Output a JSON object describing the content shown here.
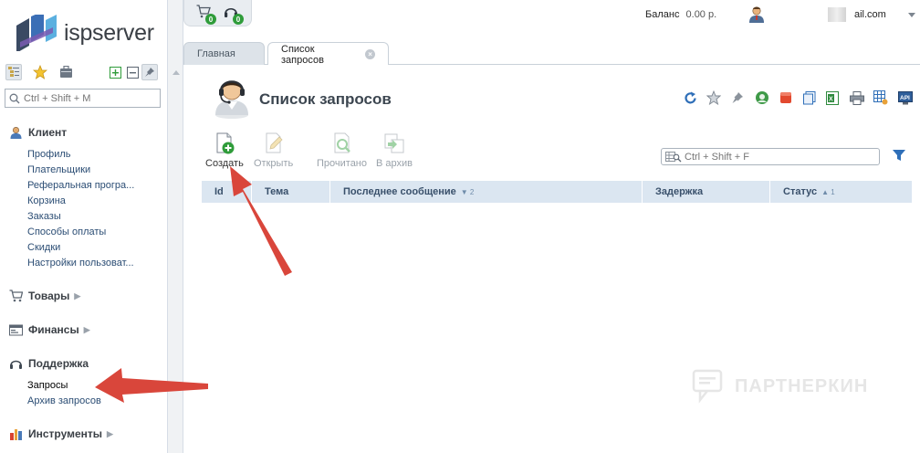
{
  "brand": {
    "logo_text": "ispserver"
  },
  "topbar": {
    "cart_badge": "0",
    "support_badge": "0",
    "balance_label": "Баланс",
    "balance_value": "0.00 р.",
    "user_email": "ail.com"
  },
  "sidebar": {
    "search_placeholder": "Ctrl + Shift + M",
    "groups": [
      {
        "title": "Клиент",
        "icon": "user-icon",
        "items": [
          "Профиль",
          "Плательщики",
          "Реферальная програ...",
          "Корзина",
          "Заказы",
          "Способы оплаты",
          "Скидки",
          "Настройки пользоват..."
        ]
      },
      {
        "title": "Товары",
        "icon": "cart-icon",
        "items": []
      },
      {
        "title": "Финансы",
        "icon": "finance-icon",
        "items": []
      },
      {
        "title": "Поддержка",
        "icon": "headset-icon",
        "items": [
          "Запросы",
          "Архив запросов"
        ]
      },
      {
        "title": "Инструменты",
        "icon": "tools-icon",
        "items": []
      }
    ]
  },
  "tabs": [
    {
      "label": "Главная",
      "active": false
    },
    {
      "label": "Список запросов",
      "active": true
    }
  ],
  "main": {
    "title": "Список запросов",
    "actions": [
      {
        "label": "Создать",
        "enabled": true,
        "icon": "create-icon"
      },
      {
        "label": "Открыть",
        "enabled": false,
        "icon": "edit-icon"
      },
      {
        "label": "Прочитано",
        "enabled": false,
        "icon": "mark-read-icon"
      },
      {
        "label": "В архив",
        "enabled": false,
        "icon": "archive-icon"
      }
    ],
    "filter_placeholder": "Ctrl + Shift + F",
    "columns": [
      {
        "label": "Id",
        "sort": ""
      },
      {
        "label": "Тема",
        "sort": ""
      },
      {
        "label": "Последнее сообщение",
        "sort": "▼ 2"
      },
      {
        "label": "Задержка",
        "sort": ""
      },
      {
        "label": "Статус",
        "sort": "▲ 1"
      }
    ]
  },
  "watermark": "ПАРТНЕРКИН"
}
